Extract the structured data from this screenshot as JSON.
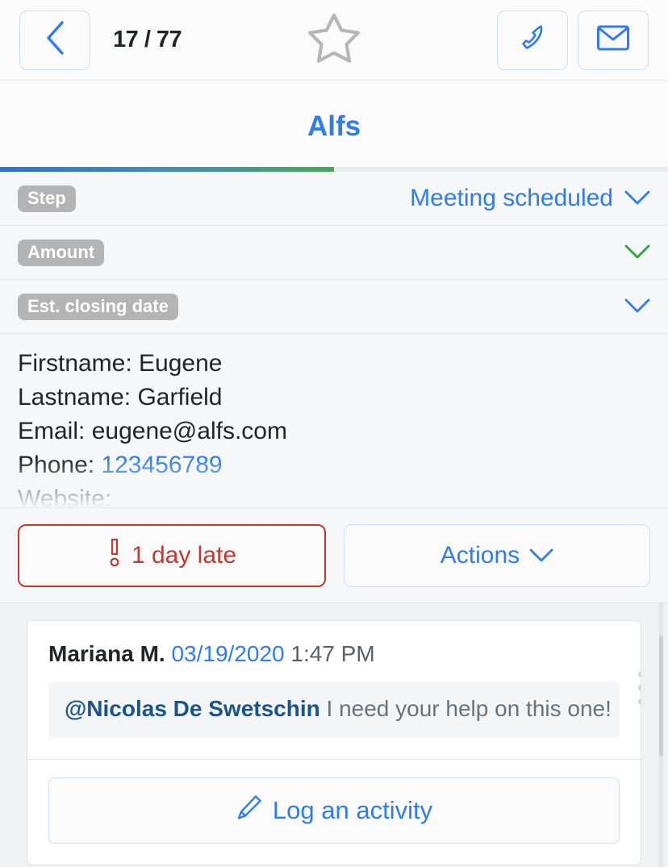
{
  "topbar": {
    "back_icon": "chevron-left-icon",
    "counter": "17 / 77",
    "star_icon": "star-outline-icon",
    "call_icon": "phone-icon",
    "mail_icon": "envelope-icon"
  },
  "header": {
    "title": "Alfs",
    "progress_percent": 50
  },
  "fields": [
    {
      "label": "Step",
      "value": "Meeting scheduled",
      "chevron": "chevron-down-icon",
      "chevron_color": "#2f7ced"
    },
    {
      "label": "Amount",
      "value": "",
      "chevron": "chevron-down-icon",
      "chevron_color": "#2aa33f"
    },
    {
      "label": "Est. closing date",
      "value": "",
      "chevron": "chevron-down-icon",
      "chevron_color": "#2f7ced"
    }
  ],
  "details": [
    {
      "label": "Firstname:",
      "value": "Eugene",
      "link": false
    },
    {
      "label": "Lastname:",
      "value": "Garfield",
      "link": false
    },
    {
      "label": "Email:",
      "value": "eugene@alfs.com",
      "link": false
    },
    {
      "label": "Phone:",
      "value": "123456789",
      "link": true
    },
    {
      "label": "Website:",
      "value": "",
      "link": false
    }
  ],
  "actions": {
    "late_icon": "exclamation-icon",
    "late_label": "1 day late",
    "actions_label": "Actions",
    "actions_chevron": "chevron-down-icon"
  },
  "timeline": {
    "comment": {
      "author": "Mariana M.",
      "date": "03/19/2020",
      "time": "1:47 PM",
      "mention": "@Nicolas De Swetschin",
      "text": "I need your help on this one!",
      "menu_icon": "kebab-menu-icon"
    },
    "log_activity": {
      "icon": "pencil-icon",
      "label": "Log an activity"
    }
  },
  "colors": {
    "accent_blue": "#2f7ced",
    "danger_red": "#c0392f",
    "success_green": "#2aa33f",
    "badge_gray": "#b4b4b4"
  }
}
